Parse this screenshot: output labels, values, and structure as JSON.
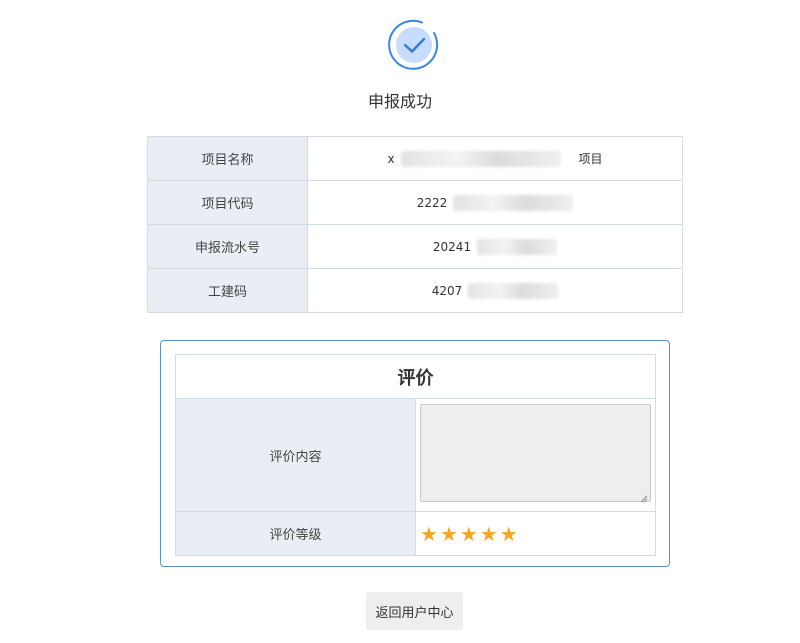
{
  "status": {
    "title": "申报成功",
    "icon": "check-circle-icon",
    "accent_color": "#3a86e8",
    "icon_fill": "#c8dcfb"
  },
  "info_table": {
    "rows": [
      {
        "label": "项目名称",
        "value_prefix": "x",
        "value_suffix": "项目"
      },
      {
        "label": "项目代码",
        "value_prefix": "2222",
        "value_suffix": ""
      },
      {
        "label": "申报流水号",
        "value_prefix": "20241",
        "value_suffix": ""
      },
      {
        "label": "工建码",
        "value_prefix": "4207",
        "value_suffix": ""
      }
    ]
  },
  "evaluation": {
    "header": "评价",
    "content_label": "评价内容",
    "content_value": "",
    "rating_label": "评价等级",
    "rating": 5,
    "rating_max": 5,
    "star_color": "#f5a623",
    "panel_border_color": "#5b93c9"
  },
  "actions": {
    "back_label": "返回用户中心"
  }
}
